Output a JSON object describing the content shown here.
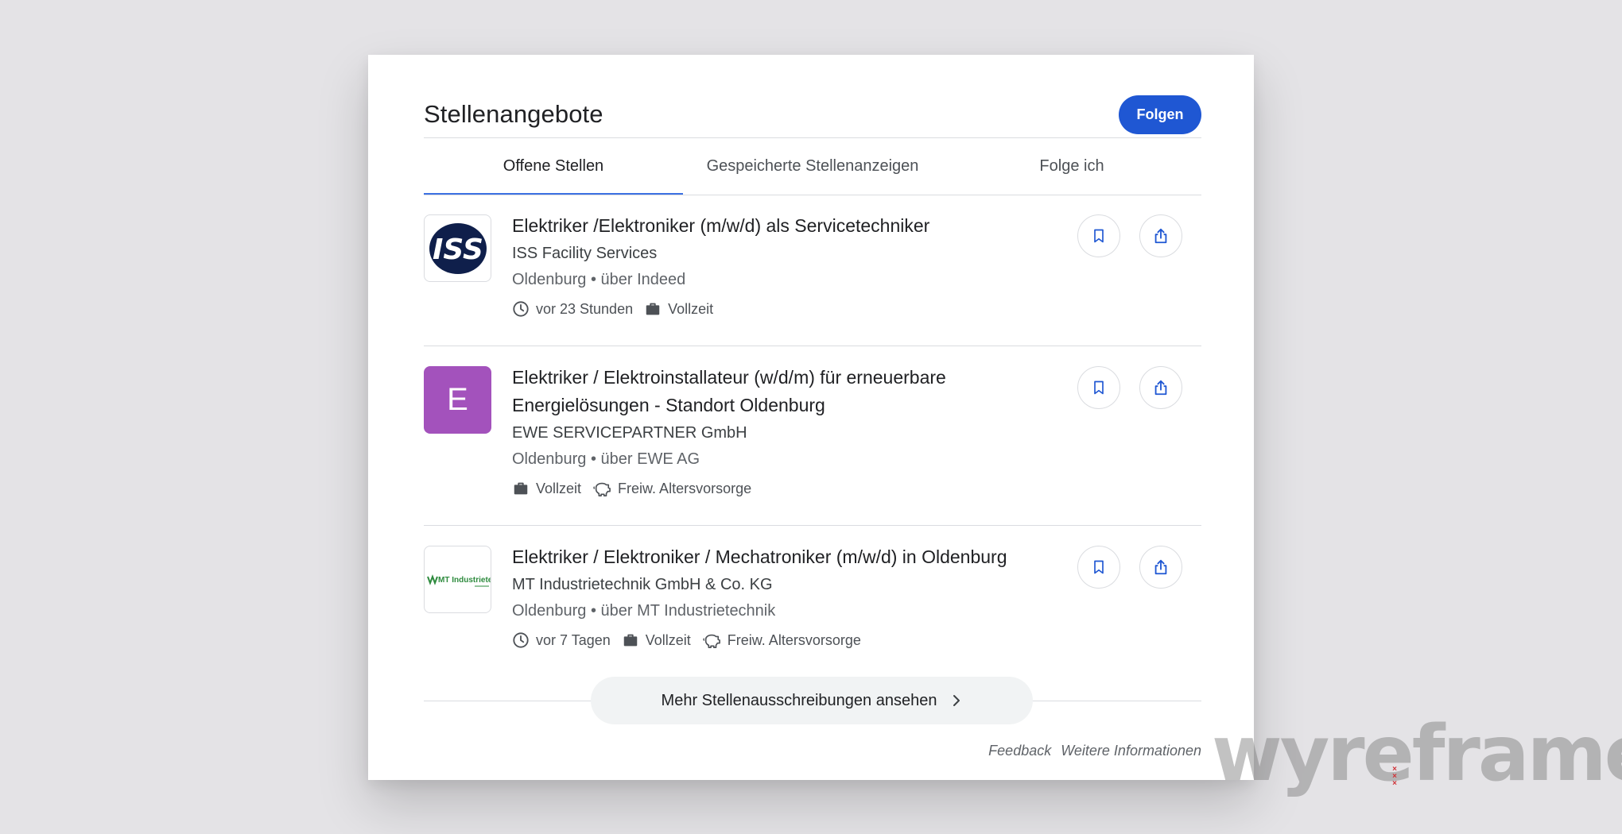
{
  "header": {
    "title": "Stellenangebote",
    "follow_label": "Folgen"
  },
  "tabs": [
    {
      "label": "Offene Stellen",
      "active": true
    },
    {
      "label": "Gespeicherte Stellenanzeigen",
      "active": false
    },
    {
      "label": "Folge ich",
      "active": false
    }
  ],
  "jobs": [
    {
      "title": "Elektriker /Elektroniker (m/w/d) als Servicetechniker",
      "company": "ISS Facility Services",
      "location": "Oldenburg • über Indeed",
      "logo_text": "ISS",
      "meta": [
        {
          "icon": "clock-icon",
          "text": "vor 23 Stunden"
        },
        {
          "icon": "briefcase-icon",
          "text": "Vollzeit"
        }
      ]
    },
    {
      "title": "Elektriker / Elektroinstallateur (w/d/m) für erneuerbare Energielösungen - Standort Oldenburg",
      "company": "EWE SERVICEPARTNER GmbH",
      "location": "Oldenburg • über EWE AG",
      "logo_text": "E",
      "meta": [
        {
          "icon": "briefcase-icon",
          "text": "Vollzeit"
        },
        {
          "icon": "piggy-bank-icon",
          "text": "Freiw. Altersvorsorge"
        }
      ]
    },
    {
      "title": "Elektriker / Elektroniker / Mechatroniker (m/w/d) in Oldenburg",
      "company": "MT Industrietechnik GmbH & Co. KG",
      "location": "Oldenburg • über MT Industrietechnik",
      "logo_text": "MT Industrietechnik",
      "meta": [
        {
          "icon": "clock-icon",
          "text": "vor 7 Tagen"
        },
        {
          "icon": "briefcase-icon",
          "text": "Vollzeit"
        },
        {
          "icon": "piggy-bank-icon",
          "text": "Freiw. Altersvorsorge"
        }
      ]
    }
  ],
  "more_label": "Mehr Stellenausschreibungen ansehen",
  "footer": {
    "feedback": "Feedback",
    "info": "Weitere Informationen"
  },
  "watermark": "wyreframe",
  "colors": {
    "accent": "#1f57d3",
    "tab_indicator": "#3d71e3",
    "letter_logo": "#a352bc",
    "background": "#e4e3e6"
  }
}
